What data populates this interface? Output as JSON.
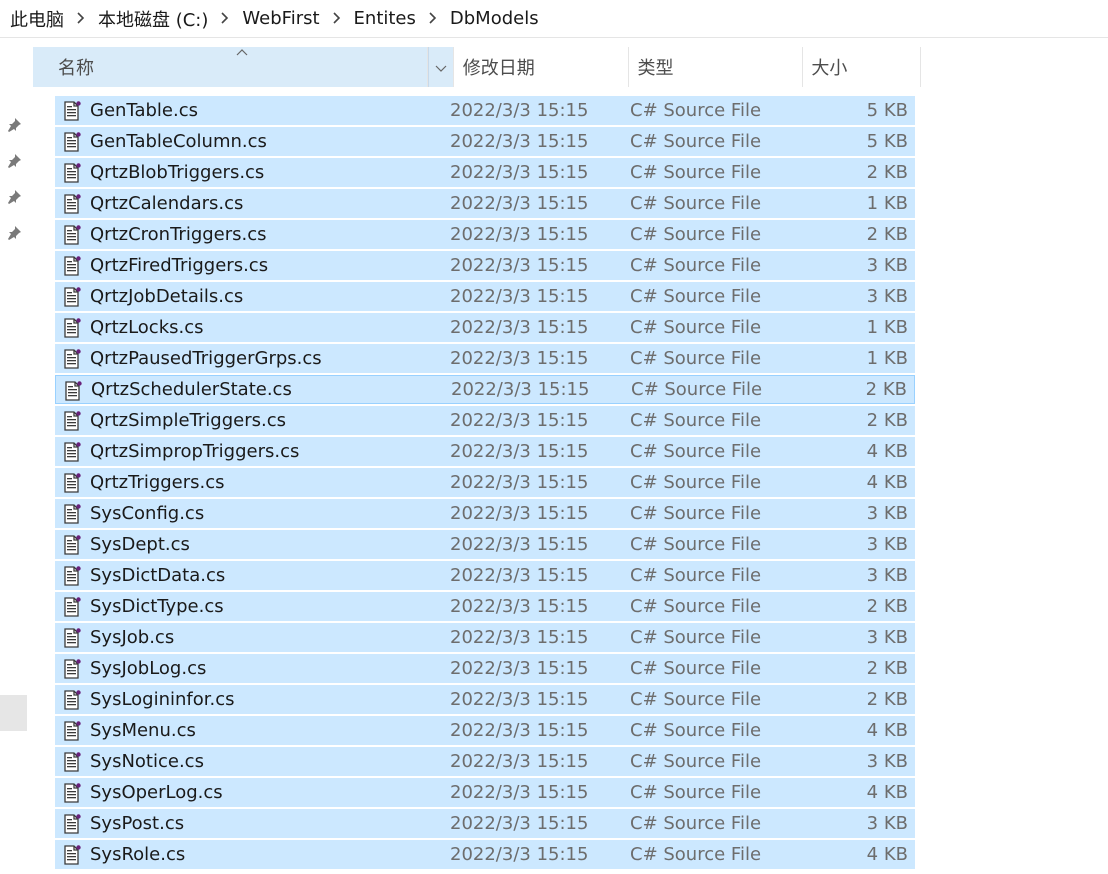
{
  "breadcrumb": [
    "此电脑",
    "本地磁盘 (C:)",
    "WebFirst",
    "Entites",
    "DbModels"
  ],
  "columns": {
    "name": "名称",
    "date": "修改日期",
    "type": "类型",
    "size": "大小"
  },
  "files": [
    {
      "name": "GenTable.cs",
      "date": "2022/3/3 15:15",
      "type": "C# Source File",
      "size": "5 KB"
    },
    {
      "name": "GenTableColumn.cs",
      "date": "2022/3/3 15:15",
      "type": "C# Source File",
      "size": "5 KB"
    },
    {
      "name": "QrtzBlobTriggers.cs",
      "date": "2022/3/3 15:15",
      "type": "C# Source File",
      "size": "2 KB"
    },
    {
      "name": "QrtzCalendars.cs",
      "date": "2022/3/3 15:15",
      "type": "C# Source File",
      "size": "1 KB"
    },
    {
      "name": "QrtzCronTriggers.cs",
      "date": "2022/3/3 15:15",
      "type": "C# Source File",
      "size": "2 KB"
    },
    {
      "name": "QrtzFiredTriggers.cs",
      "date": "2022/3/3 15:15",
      "type": "C# Source File",
      "size": "3 KB"
    },
    {
      "name": "QrtzJobDetails.cs",
      "date": "2022/3/3 15:15",
      "type": "C# Source File",
      "size": "3 KB"
    },
    {
      "name": "QrtzLocks.cs",
      "date": "2022/3/3 15:15",
      "type": "C# Source File",
      "size": "1 KB"
    },
    {
      "name": "QrtzPausedTriggerGrps.cs",
      "date": "2022/3/3 15:15",
      "type": "C# Source File",
      "size": "1 KB"
    },
    {
      "name": "QrtzSchedulerState.cs",
      "date": "2022/3/3 15:15",
      "type": "C# Source File",
      "size": "2 KB"
    },
    {
      "name": "QrtzSimpleTriggers.cs",
      "date": "2022/3/3 15:15",
      "type": "C# Source File",
      "size": "2 KB"
    },
    {
      "name": "QrtzSimpropTriggers.cs",
      "date": "2022/3/3 15:15",
      "type": "C# Source File",
      "size": "4 KB"
    },
    {
      "name": "QrtzTriggers.cs",
      "date": "2022/3/3 15:15",
      "type": "C# Source File",
      "size": "4 KB"
    },
    {
      "name": "SysConfig.cs",
      "date": "2022/3/3 15:15",
      "type": "C# Source File",
      "size": "3 KB"
    },
    {
      "name": "SysDept.cs",
      "date": "2022/3/3 15:15",
      "type": "C# Source File",
      "size": "3 KB"
    },
    {
      "name": "SysDictData.cs",
      "date": "2022/3/3 15:15",
      "type": "C# Source File",
      "size": "3 KB"
    },
    {
      "name": "SysDictType.cs",
      "date": "2022/3/3 15:15",
      "type": "C# Source File",
      "size": "2 KB"
    },
    {
      "name": "SysJob.cs",
      "date": "2022/3/3 15:15",
      "type": "C# Source File",
      "size": "3 KB"
    },
    {
      "name": "SysJobLog.cs",
      "date": "2022/3/3 15:15",
      "type": "C# Source File",
      "size": "2 KB"
    },
    {
      "name": "SysLogininfor.cs",
      "date": "2022/3/3 15:15",
      "type": "C# Source File",
      "size": "2 KB"
    },
    {
      "name": "SysMenu.cs",
      "date": "2022/3/3 15:15",
      "type": "C# Source File",
      "size": "4 KB"
    },
    {
      "name": "SysNotice.cs",
      "date": "2022/3/3 15:15",
      "type": "C# Source File",
      "size": "3 KB"
    },
    {
      "name": "SysOperLog.cs",
      "date": "2022/3/3 15:15",
      "type": "C# Source File",
      "size": "4 KB"
    },
    {
      "name": "SysPost.cs",
      "date": "2022/3/3 15:15",
      "type": "C# Source File",
      "size": "3 KB"
    },
    {
      "name": "SysRole.cs",
      "date": "2022/3/3 15:15",
      "type": "C# Source File",
      "size": "4 KB"
    }
  ],
  "focused_file": "QrtzSchedulerState.cs",
  "sort_column": "name",
  "icons": {
    "pin": "pin-icon",
    "file": "csharp-file-icon",
    "separator": "chevron-right-icon",
    "dropdown": "chevron-down-icon",
    "sort": "sort-up-icon"
  },
  "colors": {
    "selection": "#cce8ff",
    "focus_border": "#99d1ff",
    "header_hover": "#d9ebf9"
  }
}
